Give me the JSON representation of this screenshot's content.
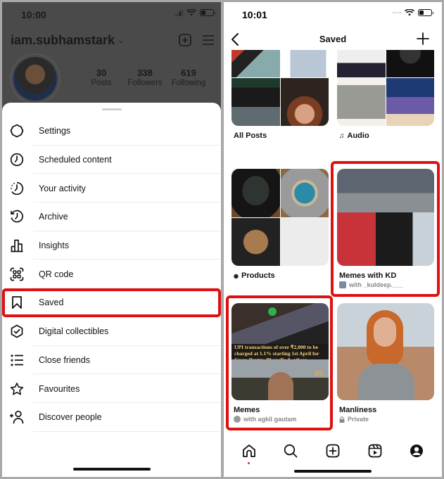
{
  "left_screen": {
    "status_bar": {
      "time": "10:00"
    },
    "profile": {
      "username": "iam.subhamstark",
      "stats": [
        {
          "value": "30",
          "label": "Posts"
        },
        {
          "value": "338",
          "label": "Followers"
        },
        {
          "value": "619",
          "label": "Following"
        }
      ]
    },
    "menu": {
      "items": [
        {
          "label": "Settings",
          "icon": "gear-icon"
        },
        {
          "label": "Scheduled content",
          "icon": "clock-icon"
        },
        {
          "label": "Your activity",
          "icon": "activity-icon"
        },
        {
          "label": "Archive",
          "icon": "archive-icon"
        },
        {
          "label": "Insights",
          "icon": "bar-chart-icon"
        },
        {
          "label": "QR code",
          "icon": "qr-code-icon"
        },
        {
          "label": "Saved",
          "icon": "bookmark-icon",
          "highlighted": true
        },
        {
          "label": "Digital collectibles",
          "icon": "check-hexagon-icon"
        },
        {
          "label": "Close friends",
          "icon": "star-list-icon"
        },
        {
          "label": "Favourites",
          "icon": "star-icon"
        },
        {
          "label": "Discover people",
          "icon": "add-person-icon"
        }
      ]
    }
  },
  "right_screen": {
    "status_bar": {
      "time": "10:01"
    },
    "navbar": {
      "title": "Saved",
      "back_icon": "chevron-left-icon",
      "add_icon": "plus-icon"
    },
    "collections": [
      {
        "name": "All Posts",
        "subtitle": ""
      },
      {
        "name": "Audio",
        "icon": "music-note-icon",
        "subtitle": ""
      },
      {
        "name": "Products",
        "icon": "shopping-bag-icon",
        "subtitle": ""
      },
      {
        "name": "Memes with KD",
        "subtitle": "with _kuldeep.___",
        "highlighted": true
      },
      {
        "name": "Memes",
        "subtitle": "with agkil gautam",
        "highlighted": true,
        "thumb_text": "UPI transactions of over ₹2,000 to be charged at 1.1% starting 1st April for Gpay, Paytm, PhonePe & others"
      },
      {
        "name": "Manliness",
        "subtitle": "Private",
        "subtitle_icon": "lock-icon"
      }
    ],
    "tabbar": [
      "home-icon",
      "search-icon",
      "create-icon",
      "reels-icon",
      "profile-icon"
    ],
    "active_tab": "home-icon"
  },
  "colors": {
    "highlight": "#e01010",
    "notification_dot": "#e0245e"
  }
}
